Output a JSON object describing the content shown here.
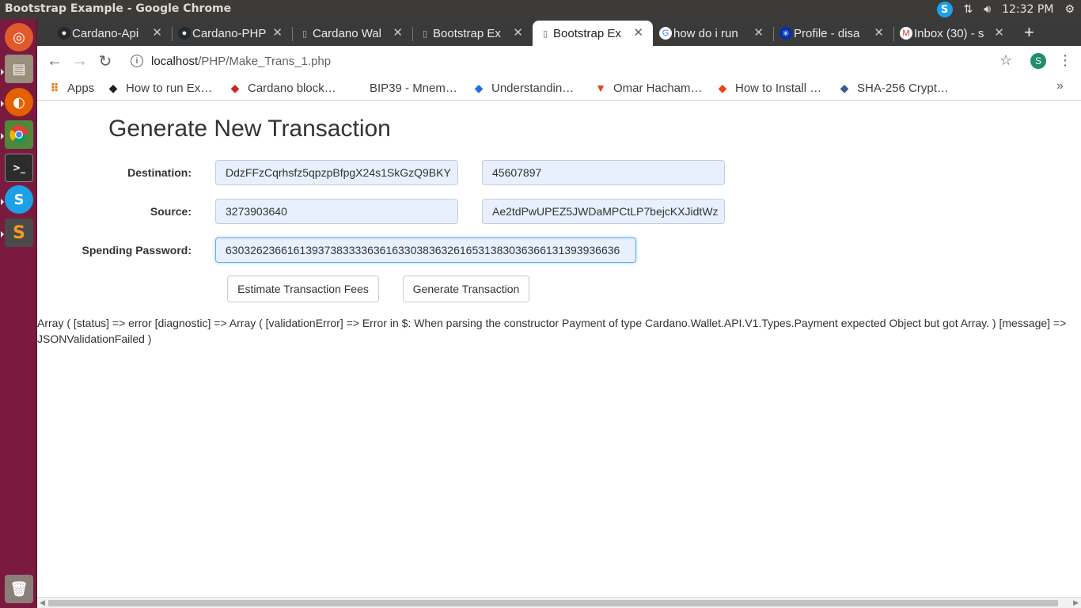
{
  "os": {
    "window_title": "Bootstrap Example - Google Chrome",
    "clock": "12:32 PM",
    "tray_icons": [
      "skype-icon",
      "network-icon",
      "volume-icon",
      "settings-gear-icon"
    ]
  },
  "launcher": {
    "items": [
      "ubuntu-dash",
      "files",
      "firefox",
      "chrome",
      "terminal",
      "skype",
      "sublime-text",
      "trash"
    ]
  },
  "browser": {
    "tabs": [
      {
        "label": "Cardano-Api",
        "icon": "github-icon"
      },
      {
        "label": "Cardano-PHP",
        "icon": "github-icon"
      },
      {
        "label": "Cardano Wal",
        "icon": "page-icon"
      },
      {
        "label": "Bootstrap Ex",
        "icon": "page-icon"
      },
      {
        "label": "Bootstrap Ex",
        "icon": "page-icon",
        "active": true
      },
      {
        "label": "how do i run",
        "icon": "google-icon"
      },
      {
        "label": "Profile - disa",
        "icon": "cardano-icon"
      },
      {
        "label": "Inbox (30) - s",
        "icon": "gmail-icon"
      }
    ],
    "url_host": "localhost",
    "url_path": "/PHP/Make_Trans_1.php",
    "profile_initial": "S",
    "bookmarks": [
      {
        "label": "Apps",
        "icon": "apps-grid-icon"
      },
      {
        "label": "How to run Ex…",
        "icon": "bookmark-icon"
      },
      {
        "label": "Cardano block…",
        "icon": "bookmark-icon"
      },
      {
        "label": "BIP39 - Mnem…",
        "icon": "none"
      },
      {
        "label": "Understandin…",
        "icon": "bookmark-icon"
      },
      {
        "label": "Omar Hacham…",
        "icon": "gitlab-icon"
      },
      {
        "label": "How to Install …",
        "icon": "bookmark-icon"
      },
      {
        "label": "SHA-256 Crypt…",
        "icon": "bookmark-icon"
      }
    ]
  },
  "page": {
    "title": "Generate New Transaction",
    "destination_label": "Destination:",
    "destination_address": "DdzFFzCqrhsfz5qpzpBfpgX24s1SkGzQ9BKY",
    "destination_amount": "45607897",
    "source_label": "Source:",
    "source_account": "3273903640",
    "source_wallet": "Ae2tdPwUPEZ5JWDaMPCtLP7bejcKXJidtWz",
    "password_label": "Spending Password:",
    "password_value": "6303262366161393738333363616330383632616531383036366131393936636",
    "estimate_button": "Estimate Transaction Fees",
    "generate_button": "Generate Transaction",
    "output_text": "Array ( [status] => error [diagnostic] => Array ( [validationError] => Error in $: When parsing the constructor Payment of type Cardano.Wallet.API.V1.Types.Payment expected Object but got Array. ) [message] => JSONValidationFailed )"
  }
}
